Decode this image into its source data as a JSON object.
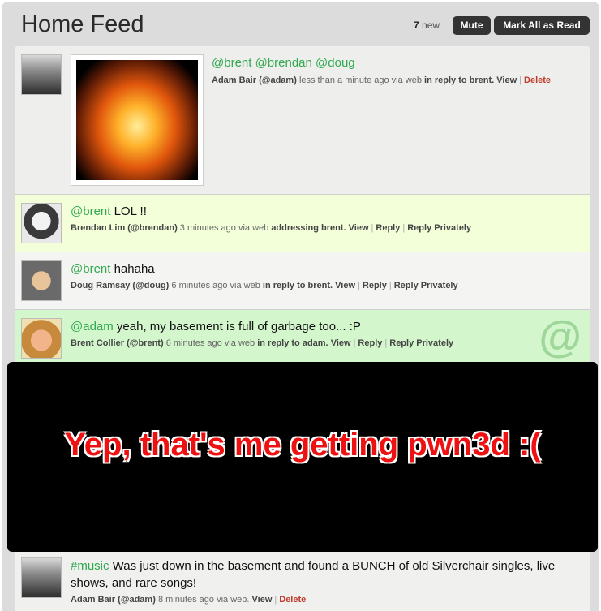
{
  "header": {
    "title": "Home Feed",
    "new_count": "7",
    "new_label": "new",
    "mute_label": "Mute",
    "mark_all_label": "Mark All as Read"
  },
  "entries": [
    {
      "mentions": "@brent @brendan @doug",
      "text": "",
      "author": "Adam Bair (@adam)",
      "time": "less than a minute ago via web",
      "reply_info": "in reply to brent.",
      "actions": [
        "View",
        "Delete"
      ]
    },
    {
      "mentions": "@brent",
      "text": " LOL !!",
      "author": "Brendan Lim (@brendan)",
      "time": "3 minutes ago via web",
      "reply_info": "addressing brent.",
      "actions": [
        "View",
        "Reply",
        "Reply Privately"
      ]
    },
    {
      "mentions": "@brent",
      "text": " hahaha",
      "author": "Doug Ramsay (@doug)",
      "time": "6 minutes ago via web",
      "reply_info": "in reply to brent.",
      "actions": [
        "View",
        "Reply",
        "Reply Privately"
      ]
    },
    {
      "mentions": "@adam",
      "text": " yeah, my basement is full of garbage too... :P",
      "author": "Brent Collier (@brent)",
      "time": "6 minutes ago via web",
      "reply_info": "in reply to adam.",
      "actions": [
        "View",
        "Reply",
        "Reply Privately"
      ]
    },
    {
      "mentions": "#music",
      "text": " Was just down in the basement and found a BUNCH of old Silverchair singles, live shows, and rare songs!",
      "author": "Adam Bair (@adam)",
      "time": "8 minutes ago via web.",
      "reply_info": "",
      "actions": [
        "View",
        "Delete"
      ]
    }
  ],
  "overlay": {
    "caption": "Yep, that's me getting pwn3d :("
  },
  "icons": {
    "mention_badge": "at-sign-icon"
  },
  "colors": {
    "mention": "#2fa84f",
    "delete": "#c0392b",
    "mention_highlight": "#d4f6cd",
    "reply_highlight": "#f3ffd9"
  }
}
